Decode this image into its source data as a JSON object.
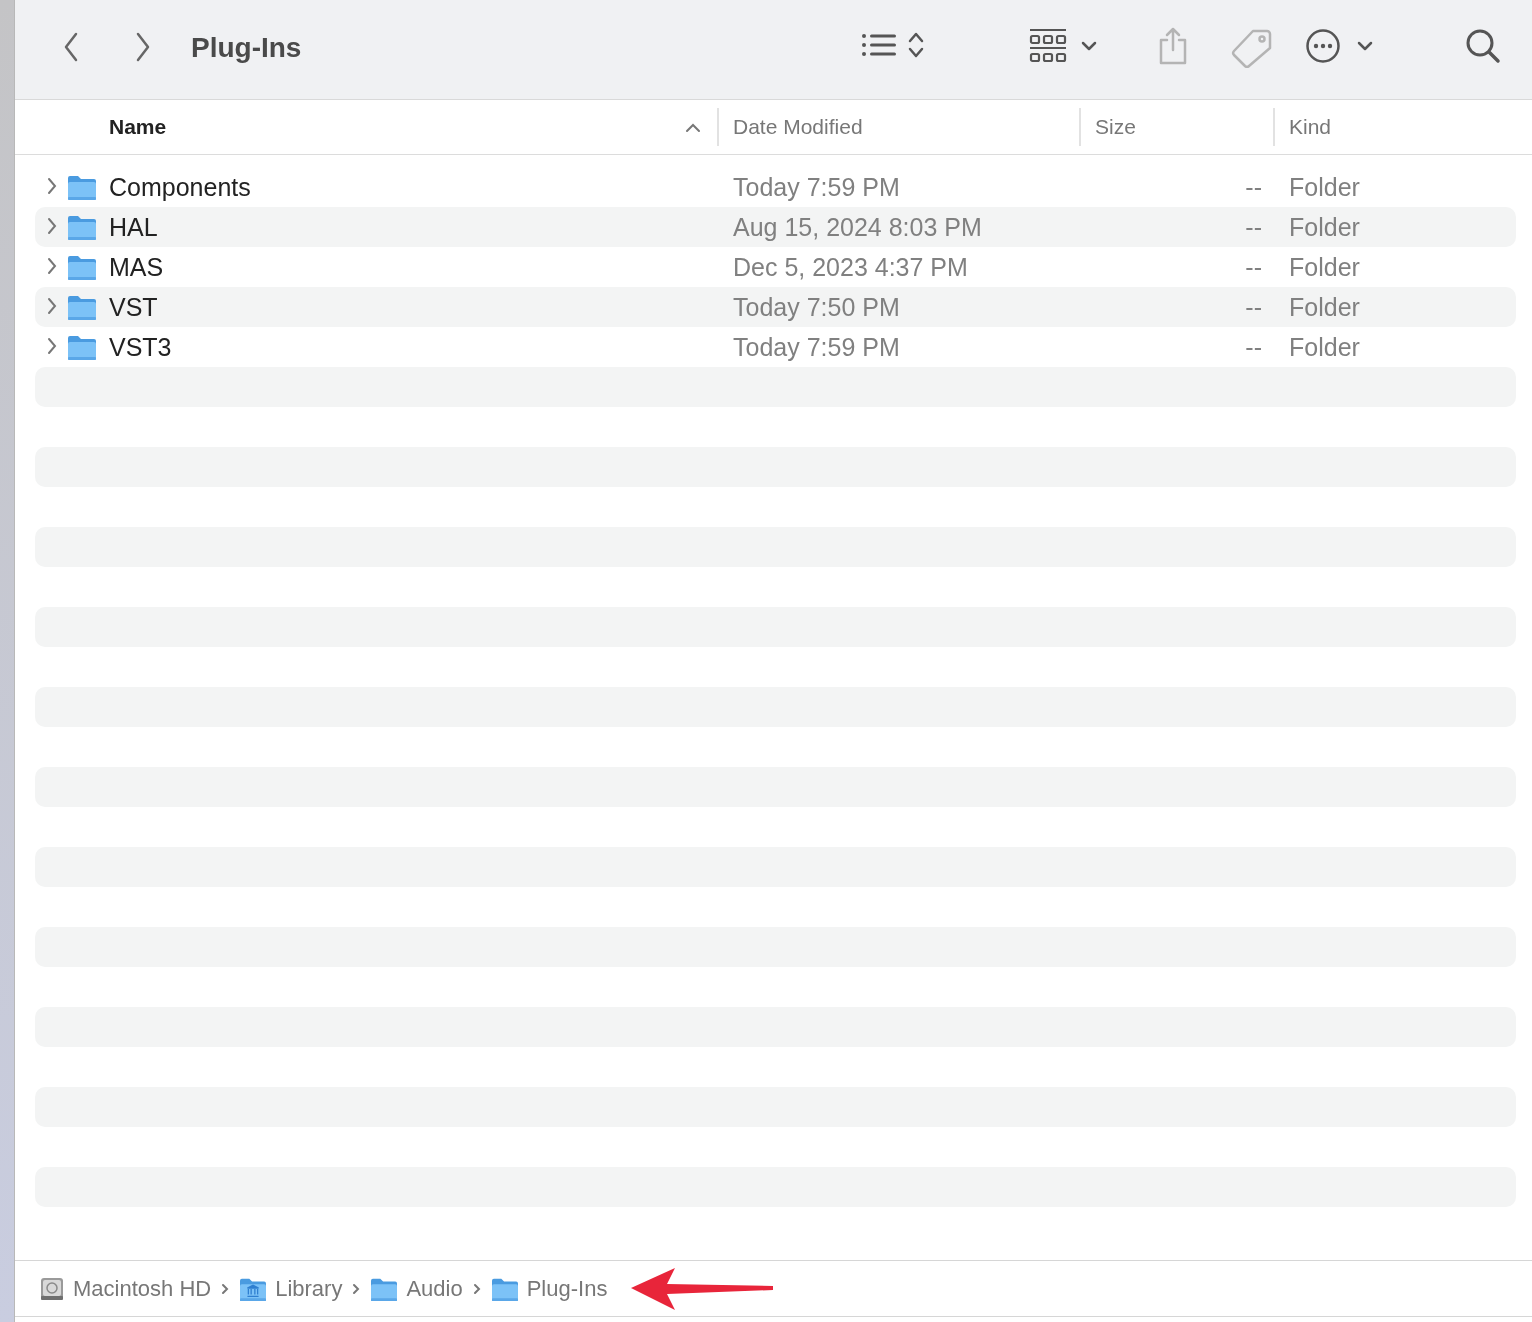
{
  "window": {
    "title": "Plug-Ins"
  },
  "toolbar": {
    "back_enabled": true,
    "forward_enabled": true,
    "share_enabled": false,
    "tags_enabled": false
  },
  "table": {
    "columns": [
      {
        "label": "Name",
        "sorted": true,
        "sort_ascending": true
      },
      {
        "label": "Date Modified",
        "sorted": false
      },
      {
        "label": "Size",
        "sorted": false
      },
      {
        "label": "Kind",
        "sorted": false
      }
    ],
    "rows": [
      {
        "name": "Components",
        "date": "Today 7:59 PM",
        "size": "--",
        "kind": "Folder",
        "expanded": false
      },
      {
        "name": "HAL",
        "date": "Aug 15, 2024 8:03 PM",
        "size": "--",
        "kind": "Folder",
        "expanded": false
      },
      {
        "name": "MAS",
        "date": "Dec 5, 2023 4:37 PM",
        "size": "--",
        "kind": "Folder",
        "expanded": false
      },
      {
        "name": "VST",
        "date": "Today 7:50 PM",
        "size": "--",
        "kind": "Folder",
        "expanded": false
      },
      {
        "name": "VST3",
        "date": "Today 7:59 PM",
        "size": "--",
        "kind": "Folder",
        "expanded": false
      }
    ]
  },
  "path_bar": [
    {
      "label": "Macintosh HD",
      "kind": "disk"
    },
    {
      "label": "Library",
      "kind": "library"
    },
    {
      "label": "Audio",
      "kind": "folder"
    },
    {
      "label": "Plug-Ins",
      "kind": "folder"
    }
  ],
  "annotation": {
    "kind": "arrow",
    "color": "#e8253a"
  }
}
